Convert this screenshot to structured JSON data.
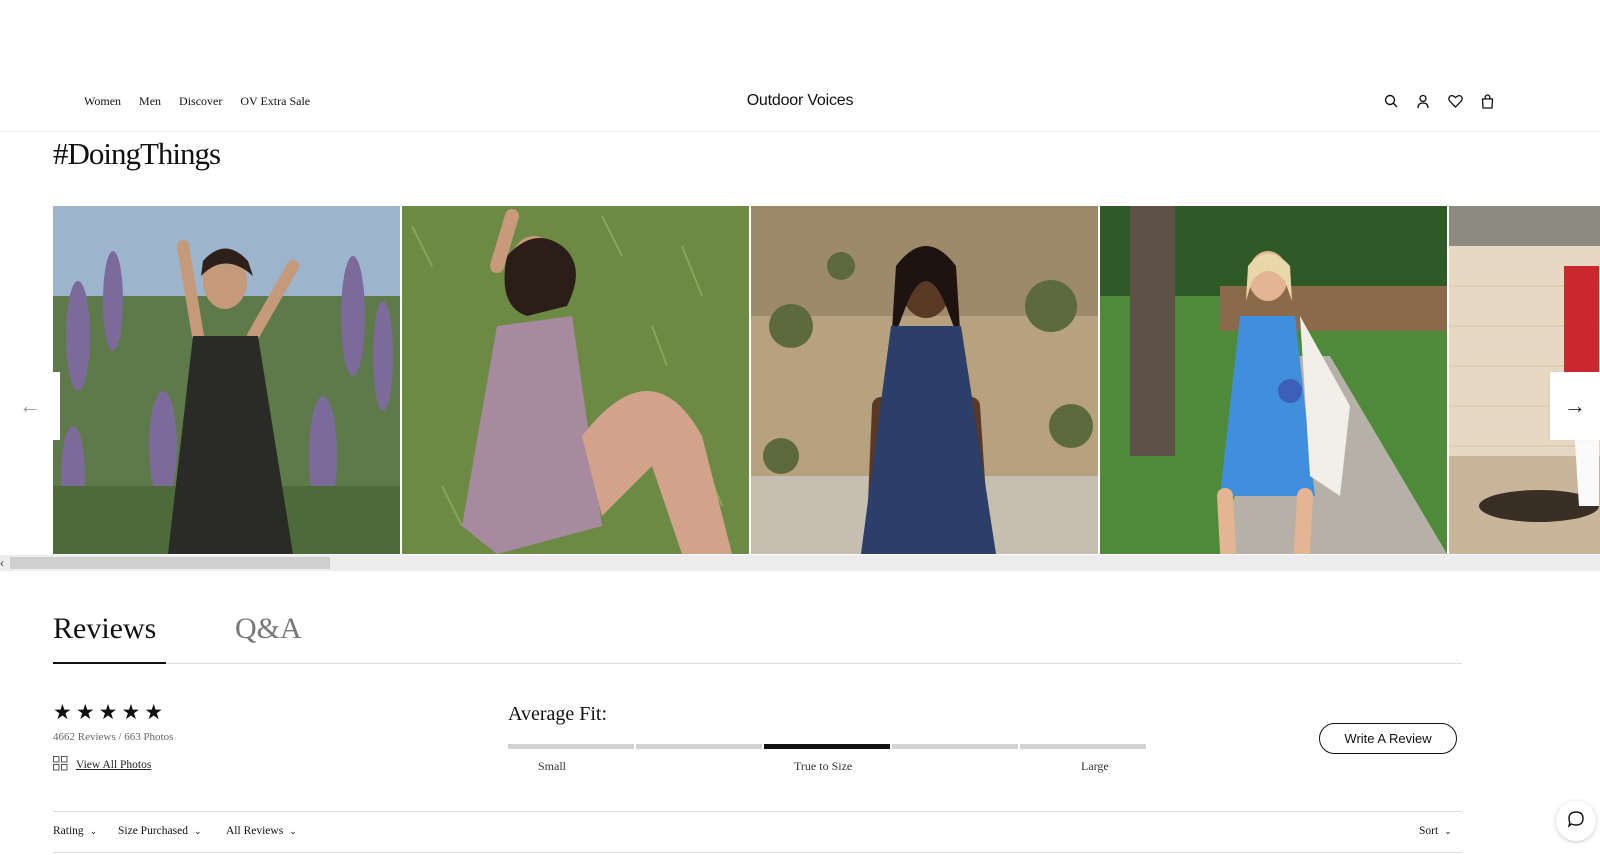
{
  "header": {
    "nav": [
      "Women",
      "Men",
      "Discover",
      "OV Extra Sale"
    ],
    "logo": "Outdoor Voices",
    "icons": [
      "search-icon",
      "account-icon",
      "wishlist-heart-icon",
      "shopping-bag-icon"
    ]
  },
  "ugc": {
    "title": "#DoingThings",
    "photos": [
      {
        "name": "ugc-photo-black-dress",
        "dress_color": "#2a2a26"
      },
      {
        "name": "ugc-photo-mauve-dress",
        "dress_color": "#a88aa0"
      },
      {
        "name": "ugc-photo-navy-dress",
        "dress_color": "#2b3f68"
      },
      {
        "name": "ugc-photo-blue-dress",
        "dress_color": "#3f8fdc"
      },
      {
        "name": "ugc-photo-red-jacket",
        "dress_color": "#c8282e"
      }
    ],
    "prev_icon": "arrow-left-icon",
    "next_icon": "arrow-right-icon"
  },
  "tabs": [
    {
      "label": "Reviews",
      "active": true
    },
    {
      "label": "Q&A",
      "active": false
    }
  ],
  "summary": {
    "stars": "★★★★★",
    "rating_stars": 5,
    "counts": "4662 Reviews / 663 Photos",
    "view_all": "View All Photos"
  },
  "fit": {
    "title": "Average Fit:",
    "labels": {
      "small": "Small",
      "true": "True to Size",
      "large": "Large"
    },
    "segments": 5,
    "selected_segment": 3
  },
  "write_review": "Write A Review",
  "filters": {
    "rating": "Rating",
    "size": "Size Purchased",
    "all": "All Reviews",
    "sort": "Sort"
  },
  "colors": {
    "accent": "#111111",
    "inactive_tab": "#777777",
    "rule": "#dedede"
  }
}
